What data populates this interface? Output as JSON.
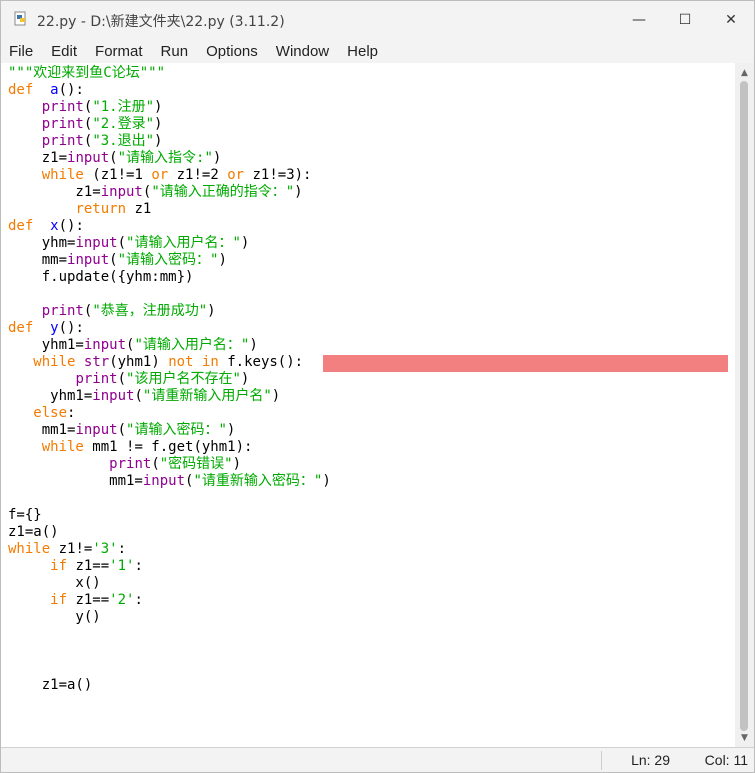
{
  "window": {
    "title": "22.py - D:\\新建文件夹\\22.py (3.11.2)"
  },
  "controls": {
    "minimize": "—",
    "maximize": "☐",
    "close": "✕"
  },
  "menu": [
    "File",
    "Edit",
    "Format",
    "Run",
    "Options",
    "Window",
    "Help"
  ],
  "status": {
    "ln": "Ln: 29",
    "col": "Col: 11"
  },
  "colors": {
    "keyword": "#f47b00",
    "builtin": "#900090",
    "string": "#00aa00",
    "definition": "#0000ff",
    "error_highlight": "#f28080"
  },
  "code_lines": [
    [
      [
        "st",
        "\"\"\"欢迎来到鱼C论坛\"\"\""
      ]
    ],
    [
      [
        "kw",
        "def"
      ],
      [
        "",
        "  "
      ],
      [
        "df",
        "a"
      ],
      [
        "",
        "():"
      ]
    ],
    [
      [
        "",
        "    "
      ],
      [
        "bi",
        "print"
      ],
      [
        "",
        "("
      ],
      [
        "st",
        "\"1.注册\""
      ],
      [
        "",
        ")"
      ]
    ],
    [
      [
        "",
        "    "
      ],
      [
        "bi",
        "print"
      ],
      [
        "",
        "("
      ],
      [
        "st",
        "\"2.登录\""
      ],
      [
        "",
        ")"
      ]
    ],
    [
      [
        "",
        "    "
      ],
      [
        "bi",
        "print"
      ],
      [
        "",
        "("
      ],
      [
        "st",
        "\"3.退出\""
      ],
      [
        "",
        ")"
      ]
    ],
    [
      [
        "",
        "    z1="
      ],
      [
        "bi",
        "input"
      ],
      [
        "",
        "("
      ],
      [
        "st",
        "\"请输入指令:\""
      ],
      [
        "",
        ")"
      ]
    ],
    [
      [
        "",
        "    "
      ],
      [
        "kw",
        "while"
      ],
      [
        "",
        " (z1!=1 "
      ],
      [
        "kw",
        "or"
      ],
      [
        "",
        " z1!=2 "
      ],
      [
        "kw",
        "or"
      ],
      [
        "",
        " z1!=3):"
      ]
    ],
    [
      [
        "",
        "        z1="
      ],
      [
        "bi",
        "input"
      ],
      [
        "",
        "("
      ],
      [
        "st",
        "\"请输入正确的指令：\""
      ],
      [
        "",
        ")"
      ]
    ],
    [
      [
        "",
        "        "
      ],
      [
        "kw",
        "return"
      ],
      [
        "",
        " z1"
      ]
    ],
    [
      [
        "kw",
        "def"
      ],
      [
        "",
        "  "
      ],
      [
        "df",
        "x"
      ],
      [
        "",
        "():"
      ]
    ],
    [
      [
        "",
        "    yhm="
      ],
      [
        "bi",
        "input"
      ],
      [
        "",
        "("
      ],
      [
        "st",
        "\"请输入用户名：\""
      ],
      [
        "",
        ")"
      ]
    ],
    [
      [
        "",
        "    mm="
      ],
      [
        "bi",
        "input"
      ],
      [
        "",
        "("
      ],
      [
        "st",
        "\"请输入密码：\""
      ],
      [
        "",
        ")"
      ]
    ],
    [
      [
        "",
        "    f.update({yhm:mm})"
      ]
    ],
    [
      [
        "",
        ""
      ]
    ],
    [
      [
        "",
        "    "
      ],
      [
        "bi",
        "print"
      ],
      [
        "",
        "("
      ],
      [
        "st",
        "\"恭喜，注册成功\""
      ],
      [
        "",
        ")"
      ]
    ],
    [
      [
        "kw",
        "def"
      ],
      [
        "",
        "  "
      ],
      [
        "df",
        "y"
      ],
      [
        "",
        "():"
      ]
    ],
    [
      [
        "",
        "    yhm1="
      ],
      [
        "bi",
        "input"
      ],
      [
        "",
        "("
      ],
      [
        "st",
        "\"请输入用户名：\""
      ],
      [
        "",
        ")"
      ]
    ],
    [
      [
        "",
        "   "
      ],
      [
        "kw",
        "while"
      ],
      [
        "",
        " "
      ],
      [
        "bi",
        "str"
      ],
      [
        "",
        "(yhm1) "
      ],
      [
        "kw",
        "not"
      ],
      [
        "",
        " "
      ],
      [
        "kw",
        "in"
      ],
      [
        "",
        " f.keys():"
      ]
    ],
    [
      [
        "",
        "        "
      ],
      [
        "bi",
        "print"
      ],
      [
        "",
        "("
      ],
      [
        "st",
        "\"该用户名不存在\""
      ],
      [
        "",
        ")"
      ]
    ],
    [
      [
        "",
        "     yhm1="
      ],
      [
        "bi",
        "input"
      ],
      [
        "",
        "("
      ],
      [
        "st",
        "\"请重新输入用户名\""
      ],
      [
        "",
        ")"
      ]
    ],
    [
      [
        "",
        "   "
      ],
      [
        "kw",
        "else"
      ],
      [
        "",
        ":"
      ]
    ],
    [
      [
        "",
        "    mm1="
      ],
      [
        "bi",
        "input"
      ],
      [
        "",
        "("
      ],
      [
        "st",
        "\"请输入密码：\""
      ],
      [
        "",
        ")"
      ]
    ],
    [
      [
        "",
        "    "
      ],
      [
        "kw",
        "while"
      ],
      [
        "",
        " mm1 != f.get(yhm1):"
      ]
    ],
    [
      [
        "",
        "            "
      ],
      [
        "bi",
        "print"
      ],
      [
        "",
        "("
      ],
      [
        "st",
        "\"密码错误\""
      ],
      [
        "",
        ")"
      ]
    ],
    [
      [
        "",
        "            mm1="
      ],
      [
        "bi",
        "input"
      ],
      [
        "",
        "("
      ],
      [
        "st",
        "\"请重新输入密码：\""
      ],
      [
        "",
        ")"
      ]
    ],
    [
      [
        "",
        ""
      ]
    ],
    [
      [
        "",
        "f={}"
      ]
    ],
    [
      [
        "",
        "z1=a()"
      ]
    ],
    [
      [
        "kw",
        "while"
      ],
      [
        "",
        " z1!="
      ],
      [
        "st",
        "'3'"
      ],
      [
        "",
        ":"
      ]
    ],
    [
      [
        "",
        "     "
      ],
      [
        "kw",
        "if"
      ],
      [
        "",
        " z1=="
      ],
      [
        "st",
        "'1'"
      ],
      [
        "",
        ":"
      ]
    ],
    [
      [
        "",
        "        x()"
      ]
    ],
    [
      [
        "",
        "     "
      ],
      [
        "kw",
        "if"
      ],
      [
        "",
        " z1=="
      ],
      [
        "st",
        "'2'"
      ],
      [
        "",
        ":"
      ]
    ],
    [
      [
        "",
        "        y()"
      ]
    ],
    [
      [
        "",
        ""
      ]
    ],
    [
      [
        "",
        ""
      ]
    ],
    [
      [
        "",
        ""
      ]
    ],
    [
      [
        "",
        "    z1=a()"
      ]
    ]
  ]
}
